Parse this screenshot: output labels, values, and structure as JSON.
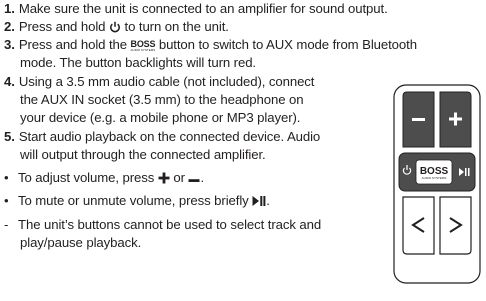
{
  "steps": [
    {
      "num": "1.",
      "text": "Make sure the unit is connected to an amplifier for sound output."
    },
    {
      "num": "2.",
      "text_before": "Press and hold ",
      "text_after": " to turn on the unit."
    },
    {
      "num": "3.",
      "text_before": "Press and hold the ",
      "text_after": " button to switch to AUX mode from Bluetooth",
      "text_cont": "mode. The button backlights will turn red."
    },
    {
      "num": "4.",
      "lines": [
        "Using a 3.5 mm audio cable (not included), connect",
        "the AUX IN socket (3.5 mm) to the headphone on",
        "your device (e.g. a mobile phone or MP3 player)."
      ]
    },
    {
      "num": "5.",
      "lines": [
        "Start audio playback on the connected device. Audio",
        "will output through the connected amplifier."
      ]
    }
  ],
  "bullets": [
    {
      "marker": "•",
      "text_before": "To adjust volume, press ",
      "text_mid": " or ",
      "text_after": "."
    },
    {
      "marker": "•",
      "text_before": "To mute or unmute volume, press briefly ",
      "text_after": "."
    }
  ],
  "note": {
    "marker": "-",
    "lines": [
      "The unit’s buttons cannot be used to select track and",
      "play/pause playback."
    ]
  },
  "logo": {
    "brand": "BOSS",
    "sub": "AUDIO SYSTEMS"
  },
  "remote": {
    "color_body": "#ffffff",
    "color_button_dark": "#4d4d4d",
    "color_button_light": "#ffffff",
    "color_outline": "#231f20"
  }
}
